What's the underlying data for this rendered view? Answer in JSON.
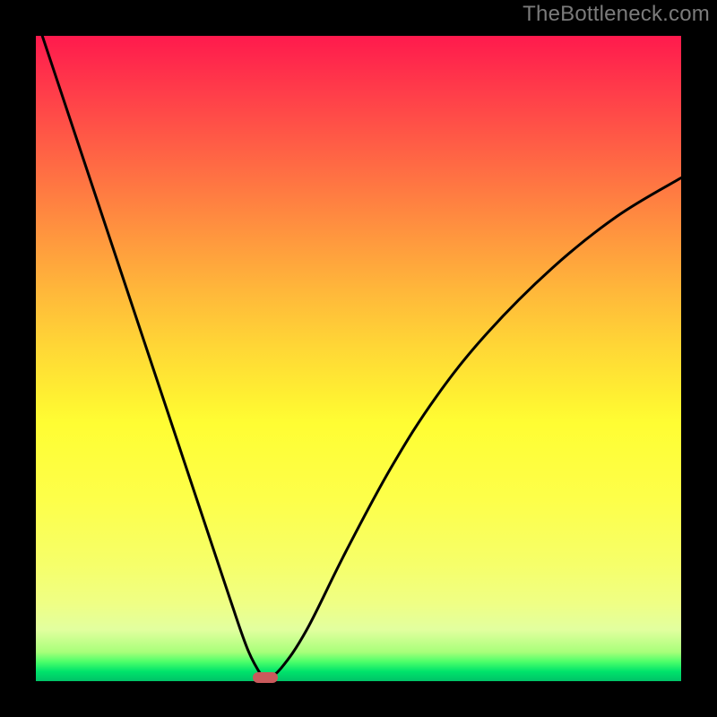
{
  "watermark": "TheBottleneck.com",
  "chart_data": {
    "type": "line",
    "title": "",
    "xlabel": "",
    "ylabel": "",
    "xlim": [
      0,
      1
    ],
    "ylim": [
      0,
      1
    ],
    "legend": false,
    "axes_visible": false,
    "grid": false,
    "background": "rainbow vertical gradient red (top) to green (bottom)",
    "series": [
      {
        "name": "bottleneck-curve",
        "comment": "V-shaped cusp curve; minimum at x≈0.355 y≈0; values are fractions of plot width/height (0 bottom-left)",
        "x": [
          0.0,
          0.05,
          0.1,
          0.15,
          0.2,
          0.25,
          0.3,
          0.33,
          0.355,
          0.38,
          0.42,
          0.48,
          0.55,
          0.62,
          0.7,
          0.8,
          0.9,
          1.0
        ],
        "y": [
          1.03,
          0.88,
          0.73,
          0.58,
          0.43,
          0.28,
          0.13,
          0.045,
          0.0,
          0.02,
          0.08,
          0.2,
          0.33,
          0.44,
          0.54,
          0.64,
          0.72,
          0.78
        ]
      }
    ],
    "marker": {
      "x": 0.355,
      "y": 0.005,
      "color": "#c95a5c",
      "shape": "rounded-rect"
    }
  },
  "colors": {
    "frame": "#000000",
    "curve": "#000000",
    "marker": "#c95a5c",
    "watermark": "#7b7b7b"
  }
}
